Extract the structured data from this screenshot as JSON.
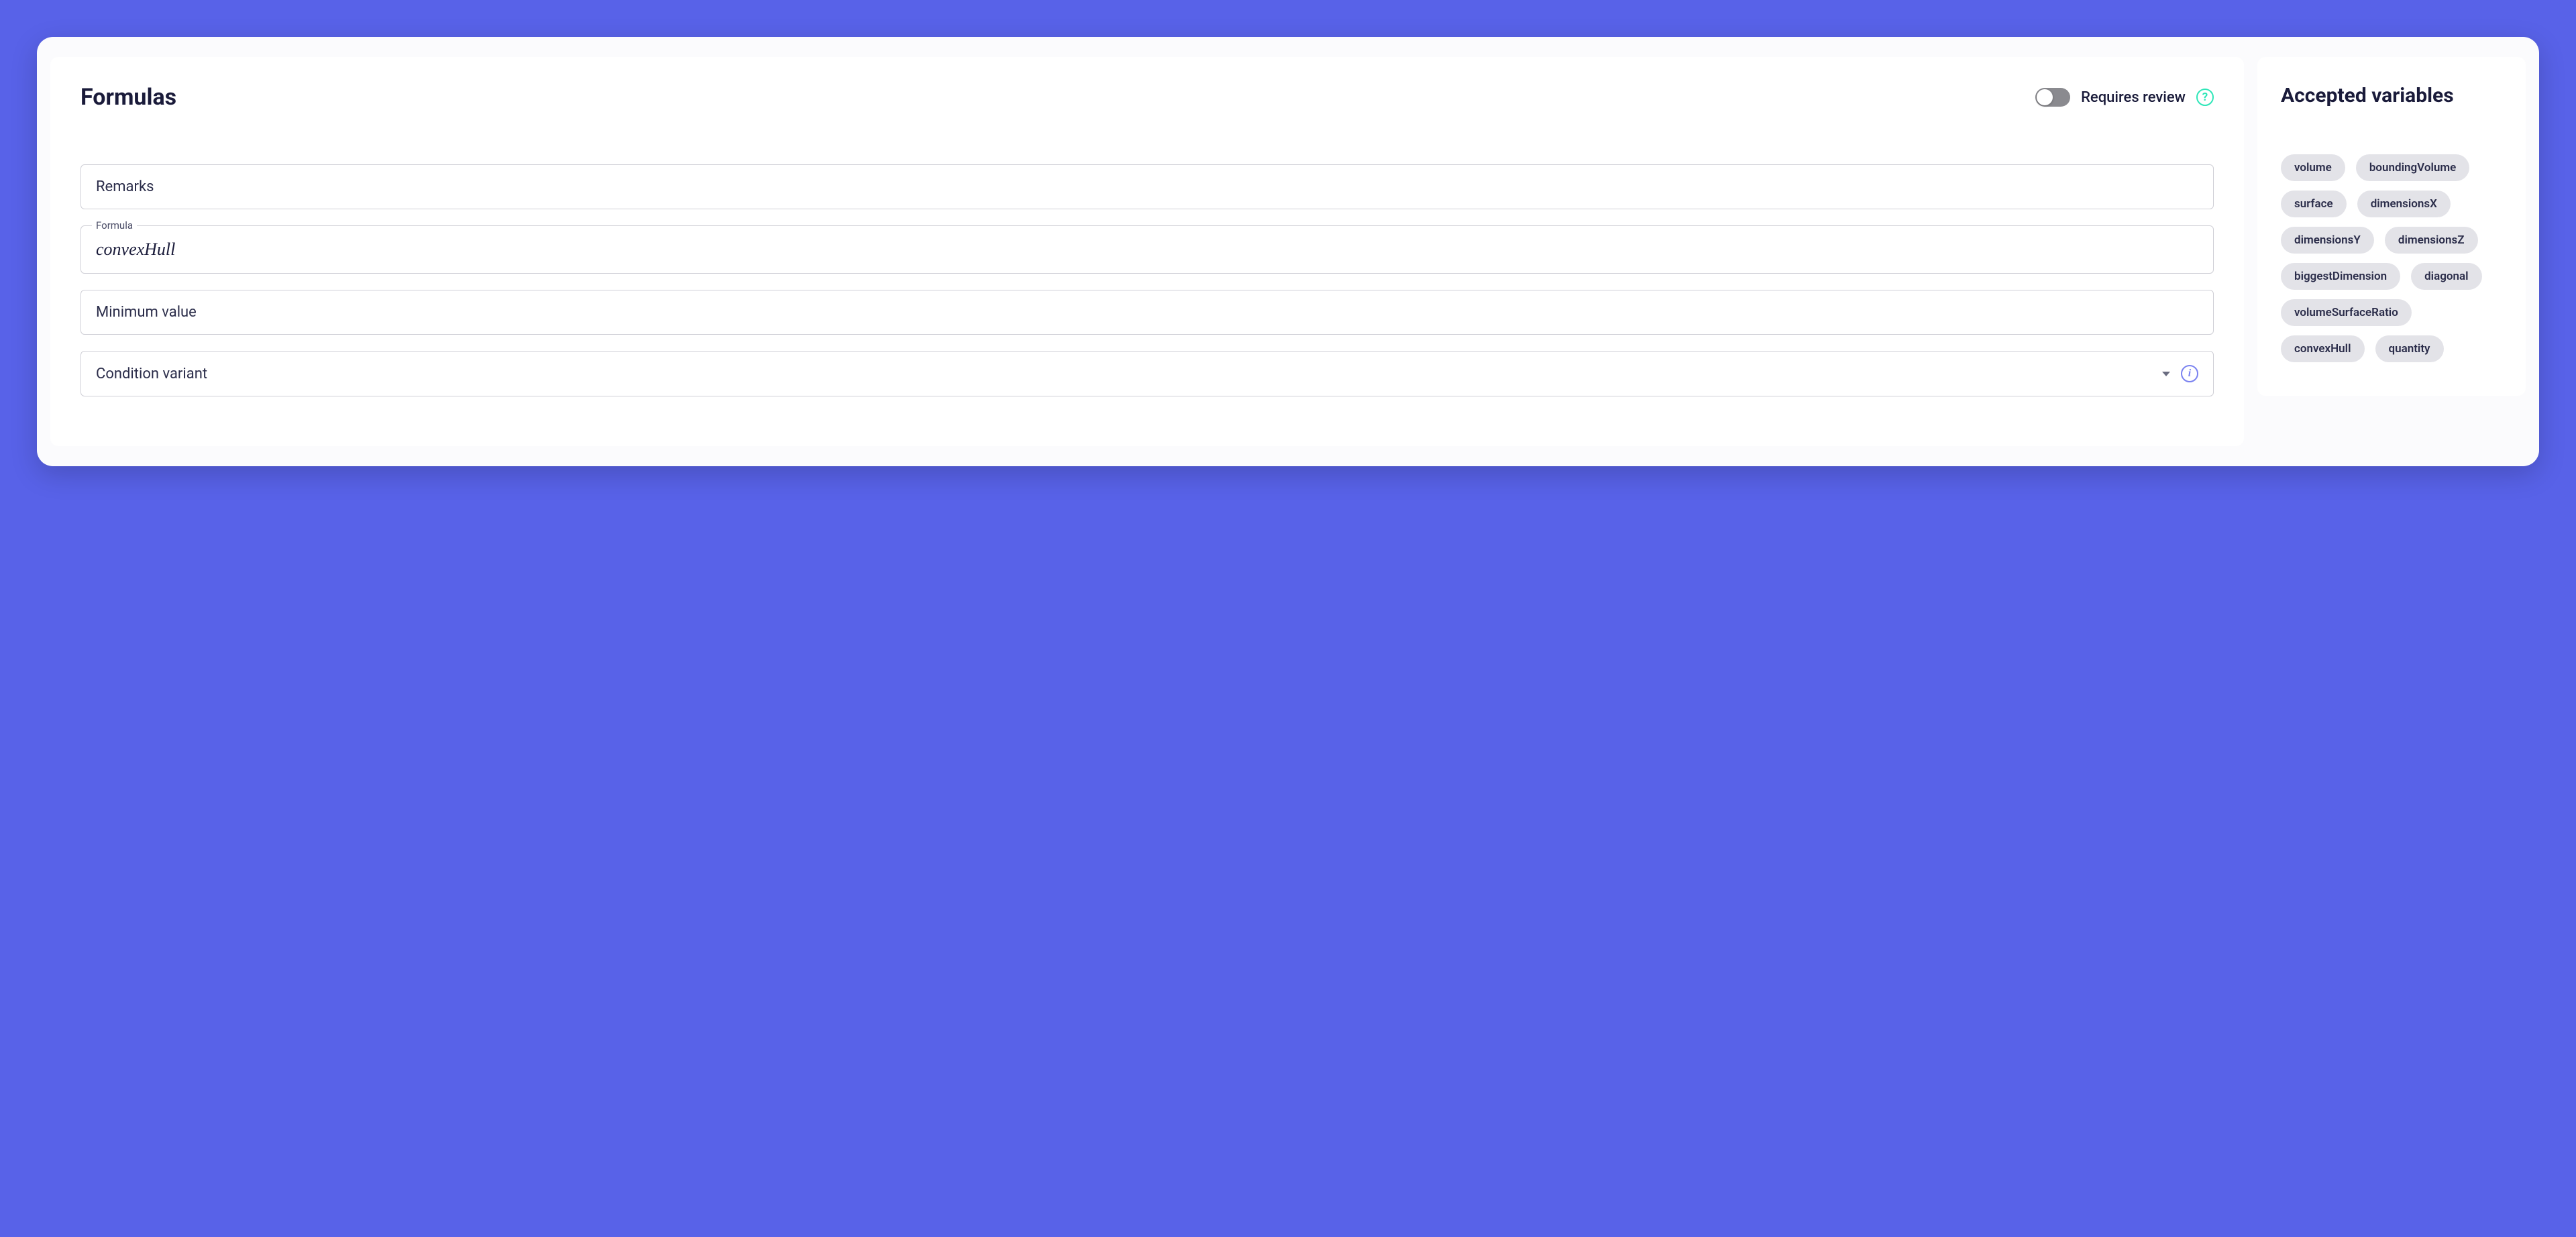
{
  "main": {
    "title": "Formulas",
    "requires_review_label": "Requires review",
    "fields": {
      "remarks_placeholder": "Remarks",
      "formula_label": "Formula",
      "formula_value": "convexHull",
      "min_value_placeholder": "Minimum value",
      "condition_variant_placeholder": "Condition variant"
    }
  },
  "sidebar": {
    "title": "Accepted variables",
    "chips": [
      "volume",
      "boundingVolume",
      "surface",
      "dimensionsX",
      "dimensionsY",
      "dimensionsZ",
      "biggestDimension",
      "diagonal",
      "volumeSurfaceRatio",
      "convexHull",
      "quantity"
    ]
  }
}
